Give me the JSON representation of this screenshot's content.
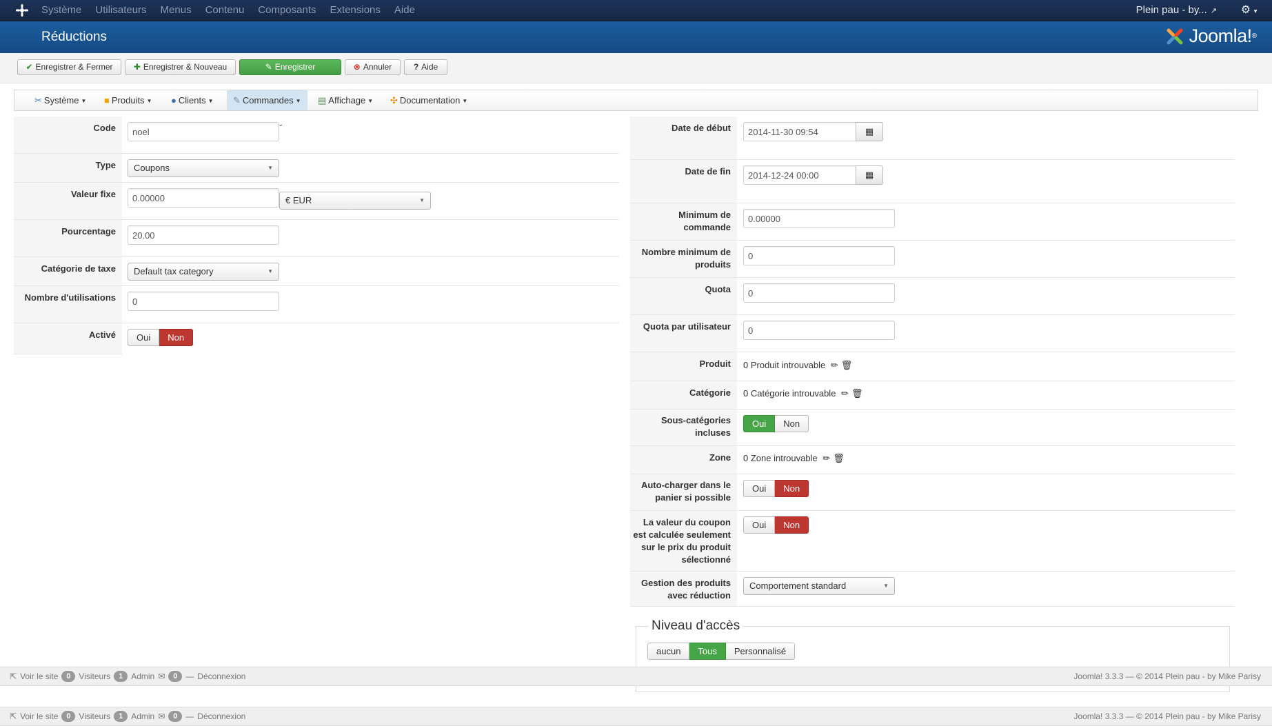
{
  "topnav": {
    "menu": [
      "Système",
      "Utilisateurs",
      "Menus",
      "Contenu",
      "Composants",
      "Extensions",
      "Aide"
    ],
    "user": "Plein pau - by...",
    "icons": {
      "logo": "joomla-logo-icon",
      "external": "external-link-icon",
      "settings": "gear-icon"
    }
  },
  "header": {
    "title": "Réductions",
    "brand": "Joomla!"
  },
  "toolbar": {
    "save_close": "Enregistrer & Fermer",
    "save_new": "Enregistrer & Nouveau",
    "save": "Enregistrer",
    "cancel": "Annuler",
    "help": "Aide"
  },
  "submenu": {
    "items": [
      "Système",
      "Produits",
      "Clients",
      "Commandes",
      "Affichage",
      "Documentation"
    ],
    "active": "Commandes"
  },
  "left_form": {
    "code": {
      "label": "Code",
      "value": "noel"
    },
    "type": {
      "label": "Type",
      "value": "Coupons"
    },
    "fixed_value": {
      "label": "Valeur fixe",
      "value": "0.00000",
      "currency": "€ EUR"
    },
    "percentage": {
      "label": "Pourcentage",
      "value": "20.00"
    },
    "tax_category": {
      "label": "Catégorie de taxe",
      "value": "Default tax category"
    },
    "uses": {
      "label": "Nombre d'utilisations",
      "value": "0"
    },
    "active": {
      "label": "Activé",
      "yes": "Oui",
      "no": "Non",
      "selected": "Non"
    }
  },
  "right_form": {
    "start_date": {
      "label": "Date de début",
      "value": "2014-11-30 09:54"
    },
    "end_date": {
      "label": "Date de fin",
      "value": "2014-12-24 00:00"
    },
    "min_order": {
      "label": "Minimum de commande",
      "value": "0.00000"
    },
    "min_products": {
      "label": "Nombre minimum de produits",
      "value": "0"
    },
    "quota": {
      "label": "Quota",
      "value": "0"
    },
    "quota_per_user": {
      "label": "Quota par utilisateur",
      "value": "0"
    },
    "product": {
      "label": "Produit",
      "value": "0 Produit introuvable"
    },
    "category": {
      "label": "Catégorie",
      "value": "0 Catégorie introuvable"
    },
    "subcategories": {
      "label": "Sous-catégories incluses",
      "yes": "Oui",
      "no": "Non",
      "selected": "Oui"
    },
    "zone": {
      "label": "Zone",
      "value": "0 Zone introuvable"
    },
    "autoload": {
      "label": "Auto-charger dans le panier si possible",
      "yes": "Oui",
      "no": "Non",
      "selected": "Non"
    },
    "coupon_value_selected": {
      "label": "La valeur du coupon est calculée seulement sur le prix du produit sélectionné",
      "yes": "Oui",
      "no": "Non",
      "selected": "Non"
    },
    "discounted_products": {
      "label": "Gestion des produits avec réduction",
      "value": "Comportement standard"
    }
  },
  "access_level": {
    "title": "Niveau d'accès",
    "options": [
      "aucun",
      "Tous",
      "Personnalisé"
    ],
    "selected": "Tous"
  },
  "status_bar": {
    "view_site": "Voir le site",
    "visitors_count": "0",
    "visitors": "Visiteurs",
    "admin_count": "1",
    "admin": "Admin",
    "messages_count": "0",
    "logout": "Déconnexion",
    "copyright": "Joomla! 3.3.3  —  © 2014 Plein pau - by Mike Parisy"
  },
  "colors": {
    "topnav": "#1a2d4d",
    "header": "#1a5796",
    "save_green": "#51a351",
    "off_red": "#bd362f",
    "on_green": "#46a546"
  }
}
